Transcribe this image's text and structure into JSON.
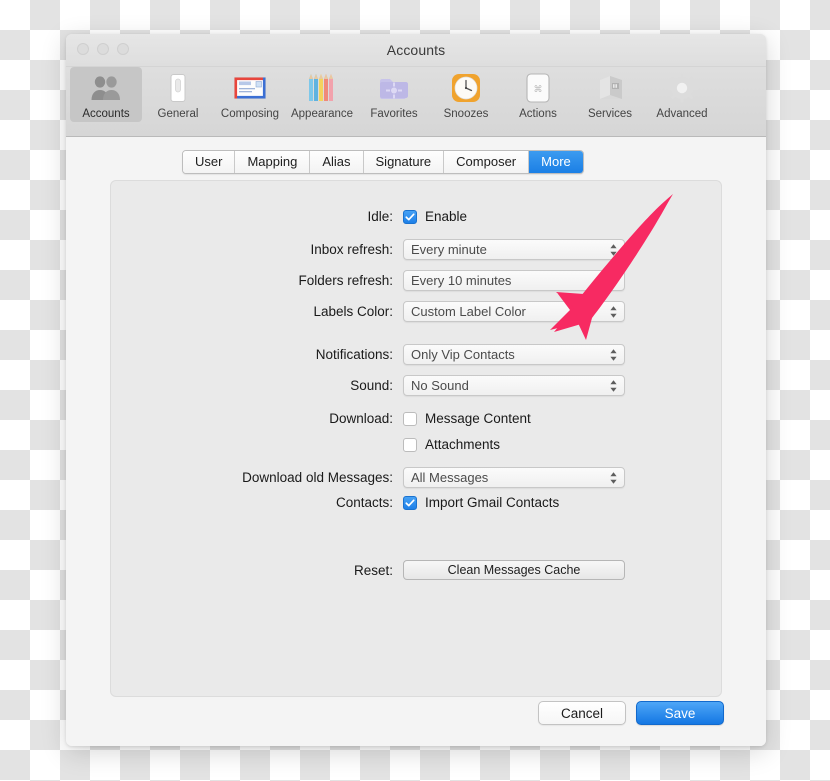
{
  "window": {
    "title": "Accounts",
    "traffic_lights": [
      "close-button",
      "minimize-button",
      "zoom-button"
    ]
  },
  "toolbar": {
    "items": [
      {
        "label": "Accounts",
        "icon": "accounts-icon",
        "selected": true
      },
      {
        "label": "General",
        "icon": "general-icon",
        "selected": false
      },
      {
        "label": "Composing",
        "icon": "composing-icon",
        "selected": false
      },
      {
        "label": "Appearance",
        "icon": "appearance-icon",
        "selected": false
      },
      {
        "label": "Favorites",
        "icon": "favorites-icon",
        "selected": false
      },
      {
        "label": "Snoozes",
        "icon": "snoozes-icon",
        "selected": false
      },
      {
        "label": "Actions",
        "icon": "actions-icon",
        "selected": false
      },
      {
        "label": "Services",
        "icon": "services-icon",
        "selected": false
      },
      {
        "label": "Advanced",
        "icon": "advanced-icon",
        "selected": false
      }
    ]
  },
  "tabs": [
    {
      "label": "User",
      "active": false
    },
    {
      "label": "Mapping",
      "active": false
    },
    {
      "label": "Alias",
      "active": false
    },
    {
      "label": "Signature",
      "active": false
    },
    {
      "label": "Composer",
      "active": false
    },
    {
      "label": "More",
      "active": true
    }
  ],
  "form": {
    "idle": {
      "label": "Idle:",
      "checkbox_label": "Enable",
      "checked": true
    },
    "inbox_refresh": {
      "label": "Inbox refresh:",
      "value": "Every minute"
    },
    "folders_refresh": {
      "label": "Folders refresh:",
      "value": "Every 10 minutes"
    },
    "labels_color": {
      "label": "Labels Color:",
      "value": "Custom Label Color"
    },
    "notifications": {
      "label": "Notifications:",
      "value": "Only Vip Contacts"
    },
    "sound": {
      "label": "Sound:",
      "value": "No Sound"
    },
    "download": {
      "label": "Download:",
      "options": [
        {
          "label": "Message Content",
          "checked": false
        },
        {
          "label": "Attachments",
          "checked": false
        }
      ]
    },
    "download_old": {
      "label": "Download old Messages:",
      "value": "All Messages"
    },
    "contacts": {
      "label": "Contacts:",
      "checkbox_label": "Import Gmail Contacts",
      "checked": true
    },
    "reset": {
      "label": "Reset:",
      "button_label": "Clean Messages Cache"
    }
  },
  "footer": {
    "cancel_label": "Cancel",
    "save_label": "Save"
  },
  "annotation": {
    "name": "red-arrow-pointing-at-notifications",
    "color": "#f72a62",
    "points_at": "Notifications:"
  },
  "colors": {
    "accent_blue": "#1b7fe5",
    "arrow_pink": "#f72a62",
    "window_chrome": "#dedede",
    "panel_bg": "#eaeaea"
  }
}
